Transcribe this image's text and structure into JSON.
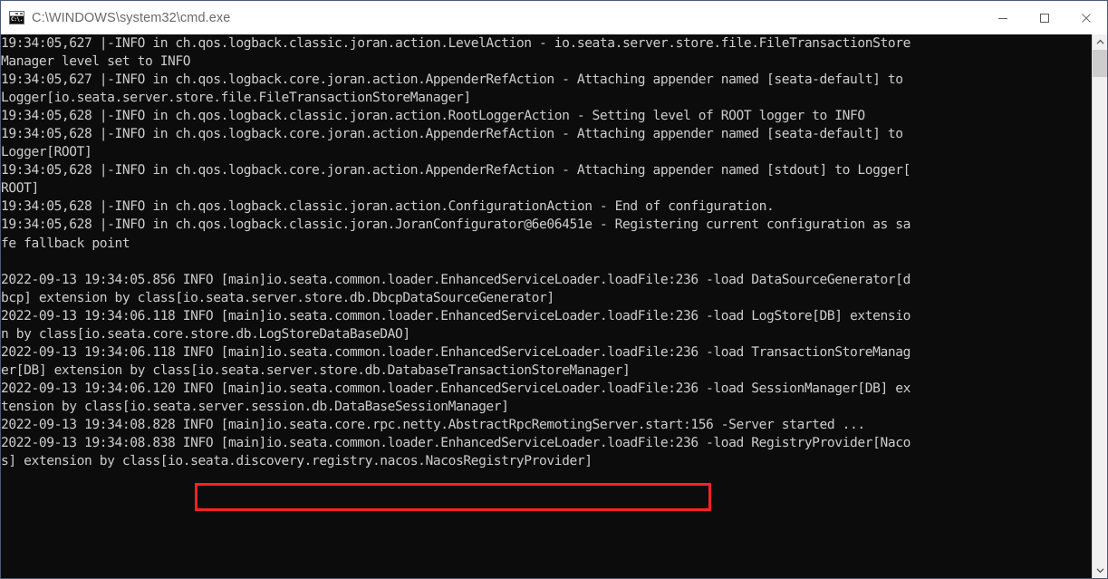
{
  "window": {
    "title": "C:\\WINDOWS\\system32\\cmd.exe",
    "icon_name": "cmd-console-icon",
    "icon_text": "C:\\.",
    "background_color": "#0c0c0c",
    "text_color": "#cccccc",
    "titlebar_color": "#ffffff",
    "border_color": "#4a5a7a"
  },
  "titlebar_buttons": {
    "minimize_label": "Minimize",
    "maximize_label": "Maximize",
    "close_label": "Close"
  },
  "annotation": {
    "color": "#ff2222",
    "target_text": "[io.seata.discovery.registry.nacos.NacosRegistryProvider]"
  },
  "scrollbar": {
    "up_arrow": "⌃",
    "down_arrow": "⌄",
    "thumb_color": "#cdcdcd",
    "track_color": "#f0f0f0"
  },
  "console": {
    "lines": [
      "19:34:05,627 |-INFO in ch.qos.logback.classic.joran.action.LevelAction - io.seata.server.store.file.FileTransactionStore",
      "Manager level set to INFO",
      "19:34:05,627 |-INFO in ch.qos.logback.core.joran.action.AppenderRefAction - Attaching appender named [seata-default] to ",
      "Logger[io.seata.server.store.file.FileTransactionStoreManager]",
      "19:34:05,628 |-INFO in ch.qos.logback.classic.joran.action.RootLoggerAction - Setting level of ROOT logger to INFO",
      "19:34:05,628 |-INFO in ch.qos.logback.core.joran.action.AppenderRefAction - Attaching appender named [seata-default] to ",
      "Logger[ROOT]",
      "19:34:05,628 |-INFO in ch.qos.logback.core.joran.action.AppenderRefAction - Attaching appender named [stdout] to Logger[",
      "ROOT]",
      "19:34:05,628 |-INFO in ch.qos.logback.classic.joran.action.ConfigurationAction - End of configuration.",
      "19:34:05,628 |-INFO in ch.qos.logback.classic.joran.JoranConfigurator@6e06451e - Registering current configuration as sa",
      "fe fallback point",
      "",
      "2022-09-13 19:34:05.856 INFO [main]io.seata.common.loader.EnhancedServiceLoader.loadFile:236 -load DataSourceGenerator[d",
      "bcp] extension by class[io.seata.server.store.db.DbcpDataSourceGenerator]",
      "2022-09-13 19:34:06.118 INFO [main]io.seata.common.loader.EnhancedServiceLoader.loadFile:236 -load LogStore[DB] extensio",
      "n by class[io.seata.core.store.db.LogStoreDataBaseDAO]",
      "2022-09-13 19:34:06.118 INFO [main]io.seata.common.loader.EnhancedServiceLoader.loadFile:236 -load TransactionStoreManag",
      "er[DB] extension by class[io.seata.server.store.db.DatabaseTransactionStoreManager]",
      "2022-09-13 19:34:06.120 INFO [main]io.seata.common.loader.EnhancedServiceLoader.loadFile:236 -load SessionManager[DB] ex",
      "tension by class[io.seata.server.session.db.DataBaseSessionManager]",
      "2022-09-13 19:34:08.828 INFO [main]io.seata.core.rpc.netty.AbstractRpcRemotingServer.start:156 -Server started ...",
      "2022-09-13 19:34:08.838 INFO [main]io.seata.common.loader.EnhancedServiceLoader.loadFile:236 -load RegistryProvider[Naco",
      "s] extension by class[io.seata.discovery.registry.nacos.NacosRegistryProvider]"
    ]
  }
}
